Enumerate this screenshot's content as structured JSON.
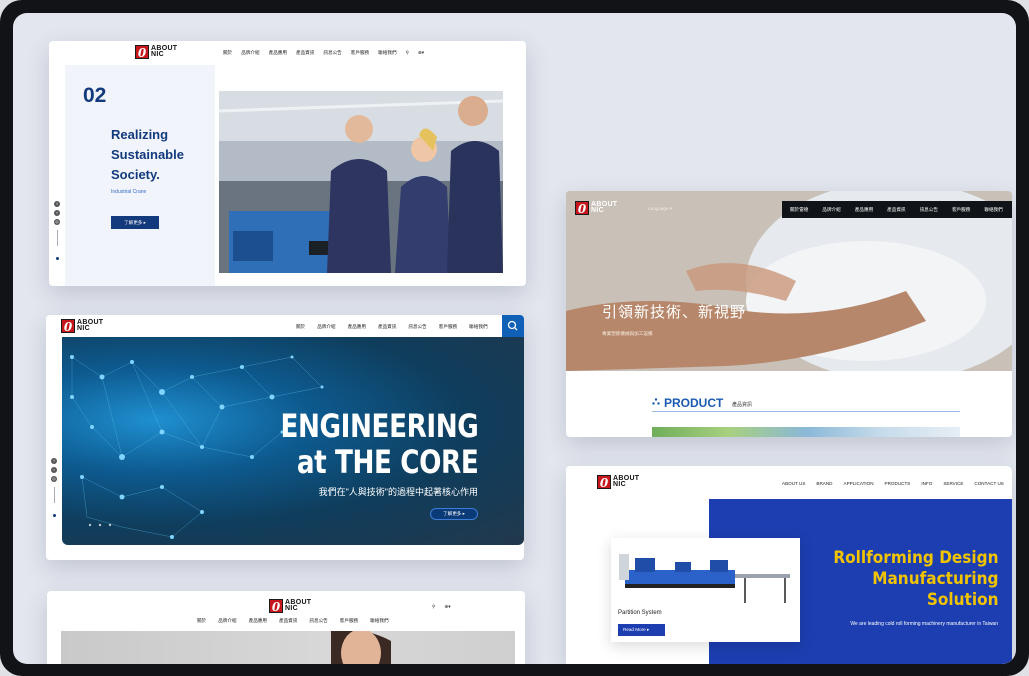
{
  "card1": {
    "nav": [
      "關於",
      "品牌介紹",
      "產品應用",
      "產品資訊",
      "訊息公告",
      "客戶服務",
      "聯絡我們"
    ],
    "slide_number": "02",
    "headline": "Realizing Sustainable Society.",
    "subtitle": "Industrial Crane",
    "cta": "了解更多 ▸"
  },
  "card2": {
    "nav": [
      "關於",
      "品牌介紹",
      "產品應用",
      "產品資訊",
      "訊息公告",
      "客戶服務",
      "聯絡我們"
    ],
    "headline_1": "ENGINEERING",
    "headline_2": "at THE CORE",
    "tagline": "我們在\"人與技術\"的過程中起著核心作用",
    "cta": "了解更多 ▸"
  },
  "card3": {
    "nav": [
      "關於",
      "品牌介紹",
      "產品應用",
      "產品資訊",
      "訊息公告",
      "客戶服務",
      "聯絡我們"
    ]
  },
  "card4": {
    "language": "Language ▾",
    "nav": [
      "關於雷德",
      "品牌介紹",
      "產品應用",
      "產品資訊",
      "訊息公告",
      "客戶服務",
      "聯絡我們"
    ],
    "headline": "引領新技術、新視野",
    "subline": "專業塑膠機械與加工設備",
    "section_title": "PRODUCT",
    "section_zh": "產品資訊"
  },
  "card5": {
    "nav": [
      "ABOUT US",
      "BRAND",
      "APPLICATION",
      "PRODUCTS",
      "INFO",
      "SERVICE",
      "CONTACT US"
    ],
    "product_name": "Partition System",
    "read_more": "Read More ▸",
    "title_lines": [
      "Rollforming Design",
      "Manufacturing",
      "Solution"
    ],
    "desc": "We are leading cold roll forming machinery manufacturer in Taiwan"
  },
  "logo": {
    "mark": "0",
    "line1": "ABOUT",
    "line2": "NIC"
  },
  "colors": {
    "navy": "#123a7c",
    "royal": "#1c3eb0",
    "yellow": "#f2c400",
    "brand_red": "#c8161d"
  }
}
